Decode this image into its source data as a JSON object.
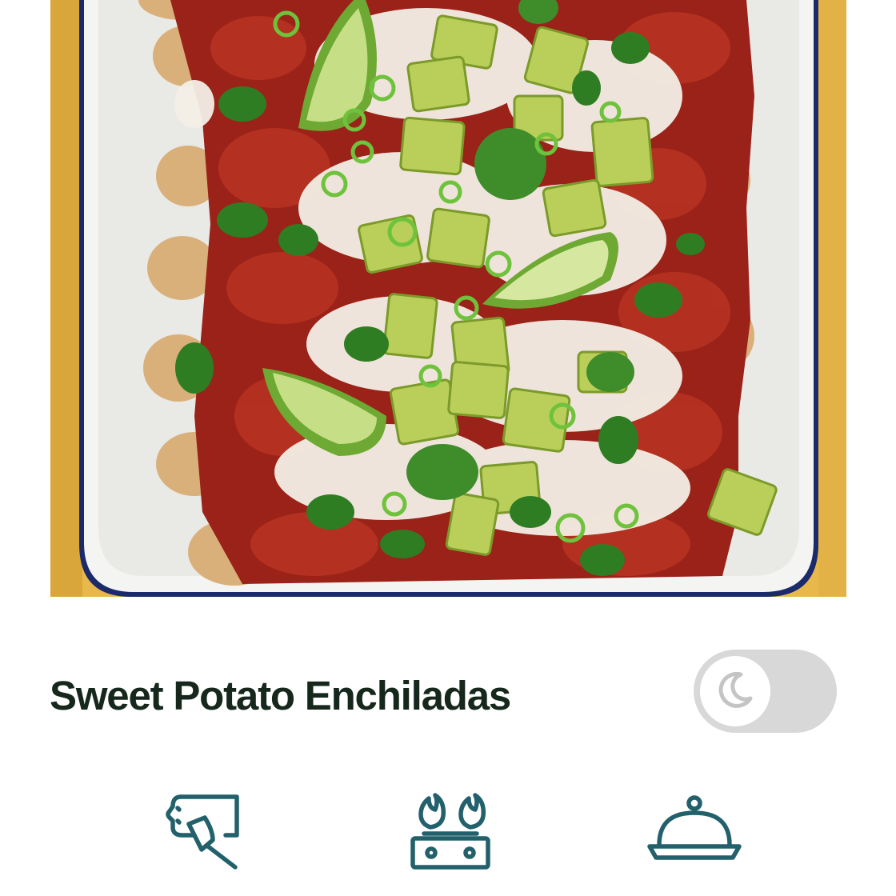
{
  "recipe": {
    "title": "Sweet Potato Enchiladas",
    "hero_image_alt": "Baking dish of sweet potato enchiladas topped with red sauce, melted cheese, avocado, spring onion, coriander and lime wedges"
  },
  "theme_toggle": {
    "state": "off",
    "icon": "moon-icon"
  },
  "tabs": [
    {
      "id": "prep",
      "icon": "cutting-board-knife-icon"
    },
    {
      "id": "cook",
      "icon": "hob-flames-icon"
    },
    {
      "id": "serve",
      "icon": "serving-cloche-icon"
    }
  ],
  "colors": {
    "title": "#16271c",
    "icon_teal": "#22616b",
    "toggle_track": "#d8d8d8",
    "toggle_moon": "#c4c4c4"
  }
}
